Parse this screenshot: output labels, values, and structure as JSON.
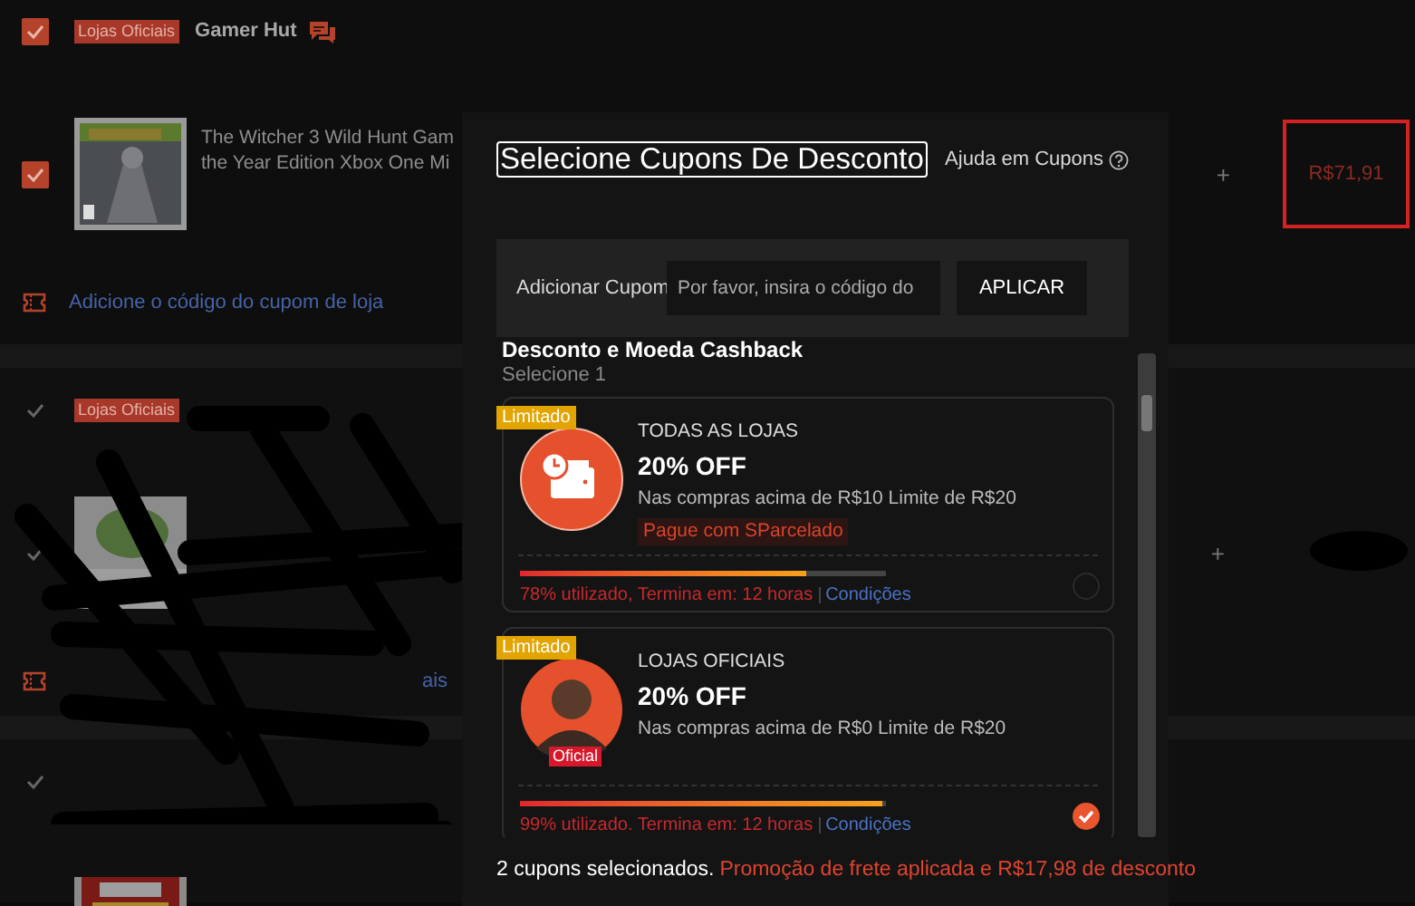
{
  "cart": {
    "stores": [
      {
        "checked": true,
        "badge": "Lojas Oficiais",
        "name": "Gamer Hut",
        "items": [
          {
            "checked": true,
            "title_lines": [
              "The Witcher 3 Wild Hunt Gam",
              "the Year Edition Xbox One Mi"
            ],
            "quantity_button": "+",
            "price": "R$71,91"
          }
        ],
        "coupon_link": "Adicione o código do cupom de loja"
      },
      {
        "checked": false,
        "badge": "Lojas Oficiais",
        "items": [
          {
            "checked": false,
            "quantity_button": "+"
          }
        ],
        "coupon_link": "ais"
      },
      {
        "checked": false
      }
    ]
  },
  "coupon_modal": {
    "title": "Selecione Cupons De Desconto",
    "help_link": "Ajuda em Cupons",
    "add_coupon": {
      "label": "Adicionar Cupom",
      "placeholder": "Por favor, insira o código do",
      "button": "APLICAR"
    },
    "section": {
      "title": "Desconto e Moeda Cashback",
      "subtitle": "Selecione 1"
    },
    "coupons": [
      {
        "kind": "wallet",
        "badge": "Limitado",
        "scope": "TODAS AS LOJAS",
        "discount": "20% OFF",
        "condition": "Nas compras acima de R$10 Limite de R$20",
        "tag": "Pague com SParcelado",
        "level": 0.78,
        "usage": "78% utilizado, Termina em: 12 horas",
        "conditions_link": "Condições",
        "selected": false
      },
      {
        "kind": "official",
        "badge": "Limitado",
        "avatar_tag": "Oficial",
        "scope": "LOJAS OFICIAIS",
        "discount": "20% OFF",
        "condition": "Nas compras acima de R$0 Limite de R$20",
        "level": 0.99,
        "usage": "99% utilizado. Termina em: 12 horas",
        "conditions_link": "Condições",
        "selected": true
      }
    ],
    "footer": {
      "count": "2 cupons selecionados.",
      "promo": "Promoção de frete aplicada e R$17,98 de desconto"
    }
  }
}
